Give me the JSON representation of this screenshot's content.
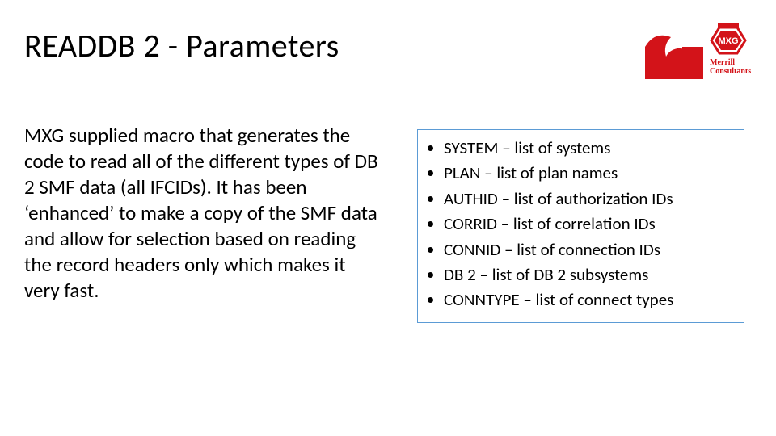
{
  "title": "READDB 2 - Parameters",
  "logo": {
    "line1": "Merrill",
    "line2": "Consultants",
    "badge": "MXG"
  },
  "body": "MXG supplied macro that generates the code to read all of the different types of DB 2 SMF data (all IFCIDs).  It has been ‘enhanced’ to make a copy of the SMF data and allow for selection based on reading the record headers only which makes it very fast.",
  "params": [
    "SYSTEM – list of systems",
    "PLAN – list of plan names",
    "AUTHID – list of authorization IDs",
    "CORRID – list of correlation IDs",
    "CONNID – list of connection IDs",
    "DB 2 – list of DB 2 subsystems",
    "CONNTYPE – list of connect types"
  ]
}
